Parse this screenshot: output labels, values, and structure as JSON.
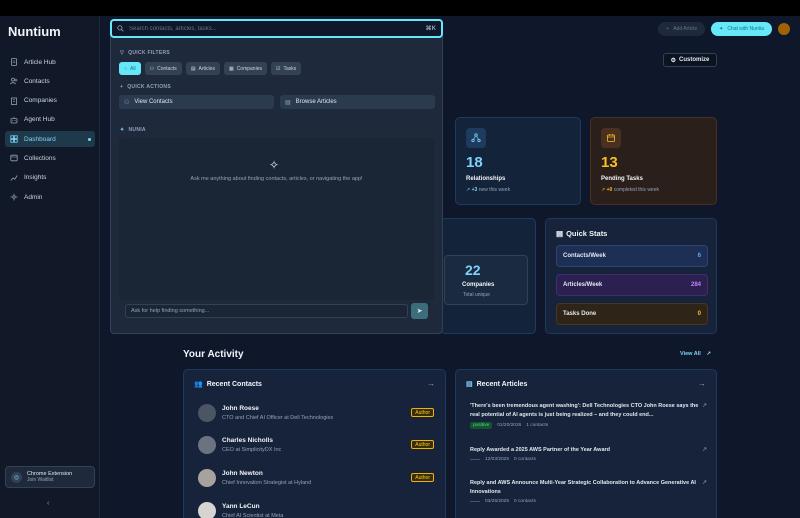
{
  "app": {
    "title": "Nuntium"
  },
  "sidebar": {
    "items": [
      {
        "label": "Article Hub",
        "icon": "document-icon"
      },
      {
        "label": "Contacts",
        "icon": "users-icon"
      },
      {
        "label": "Companies",
        "icon": "building-icon"
      },
      {
        "label": "Agent Hub",
        "icon": "bot-icon"
      },
      {
        "label": "Dashboard",
        "icon": "dashboard-icon",
        "active": true
      },
      {
        "label": "Collections",
        "icon": "folder-icon"
      },
      {
        "label": "Insights",
        "icon": "chart-icon"
      },
      {
        "label": "Admin",
        "icon": "shield-icon"
      }
    ],
    "extension": {
      "title": "Chrome Extension",
      "subtitle": "Join Waitlist"
    },
    "collapse_icon": "chevron-left-icon"
  },
  "header": {
    "add_label": "Add Article",
    "chat_label": "Chat with Nuntia",
    "customize_label": "Customize"
  },
  "search": {
    "placeholder": "Search contacts, articles, tasks...",
    "shortcut": "⌘K",
    "filters_label": "QUICK FILTERS",
    "filters": [
      "All",
      "Contacts",
      "Articles",
      "Companies",
      "Tasks"
    ],
    "actions_label": "QUICK ACTIONS",
    "actions": [
      "View Contacts",
      "Browse Articles"
    ],
    "assistant_label": "NUNIA",
    "assistant_hint": "Ask me anything about finding contacts, articles, or navigating the app!",
    "chat_placeholder": "Ask for help finding something..."
  },
  "stats": {
    "relationships": {
      "value": "18",
      "label": "Relationships",
      "delta": "+3",
      "delta_text": "new this week"
    },
    "pending": {
      "value": "13",
      "label": "Pending Tasks",
      "delta": "+0",
      "delta_text": "completed this week"
    },
    "companies": {
      "value": "22",
      "label": "Companies",
      "sub": "Total unique"
    }
  },
  "quick_stats": {
    "title": "Quick Stats",
    "rows": [
      {
        "label": "Contacts/Week",
        "value": "6",
        "color": "#60a5fa"
      },
      {
        "label": "Articles/Week",
        "value": "284",
        "color": "#c084fc"
      },
      {
        "label": "Tasks Done",
        "value": "0",
        "color": "#fbbf24"
      }
    ]
  },
  "activity": {
    "title": "Your Activity",
    "view_all": "View All",
    "recent_contacts": {
      "title": "Recent Contacts",
      "items": [
        {
          "name": "John Roese",
          "role": "CTO and Chief AI Officer at Dell Technologies",
          "badge": "Author"
        },
        {
          "name": "Charles Nicholls",
          "role": "CEO at SimplicityDX Inc",
          "badge": "Author"
        },
        {
          "name": "John Newton",
          "role": "Chief Innovation Strategist at Hyland",
          "badge": "Author"
        },
        {
          "name": "Yann LeCun",
          "role": "Chief AI Scientist at Meta",
          "badge": ""
        }
      ]
    },
    "recent_articles": {
      "title": "Recent Articles",
      "items": [
        {
          "title": "'There's been tremendous agent washing': Dell Technologies CTO John Roese says the real potential of AI agents is just being realized – and they could end...",
          "sentiment": "positive",
          "date": "01/20/2026",
          "contacts": "1 contacts"
        },
        {
          "title": "Reply Awarded a 2025 AWS Partner of the Year Award",
          "sentiment": "",
          "date": "12/03/2025",
          "contacts": "0 contacts"
        },
        {
          "title": "Reply and AWS Announce Multi-Year Strategic Collaboration to Advance Generative AI Innovations",
          "sentiment": "",
          "date": "03/25/2025",
          "contacts": "0 contacts"
        }
      ]
    }
  }
}
